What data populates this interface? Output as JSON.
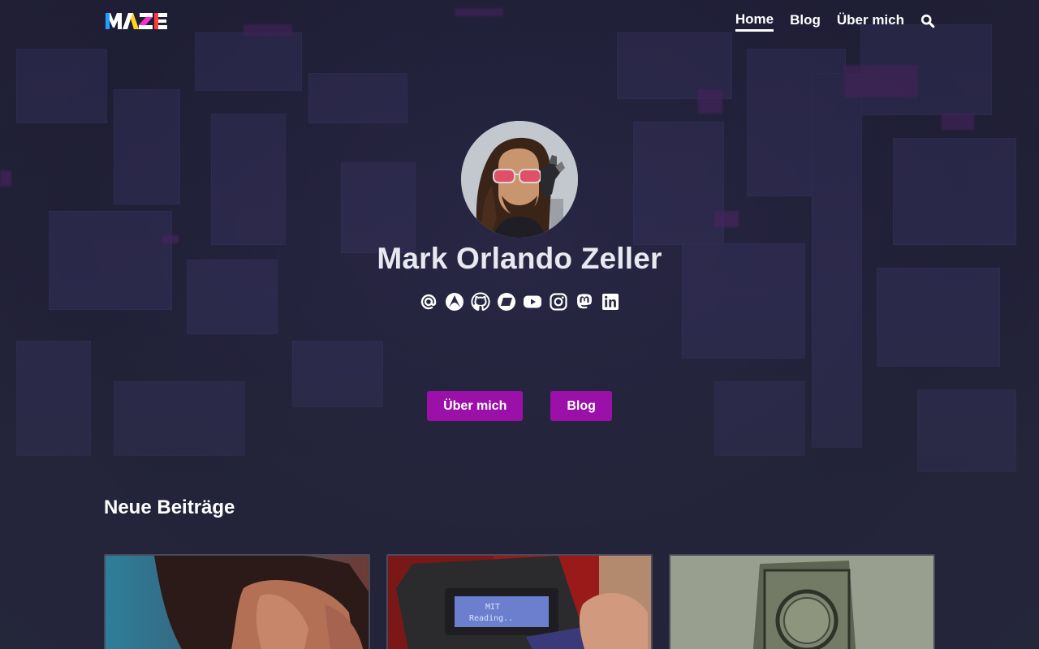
{
  "header": {
    "logo_letters": [
      "M",
      "A",
      "Z",
      "E"
    ],
    "nav": [
      {
        "label": "Home",
        "active": true
      },
      {
        "label": "Blog",
        "active": false
      },
      {
        "label": "Über mich",
        "active": false
      }
    ],
    "search_icon": "search-icon"
  },
  "hero": {
    "name": "Mark Orlando Zeller",
    "social_icons": [
      "at-icon",
      "arch-icon",
      "github-icon",
      "slanted-box-icon",
      "youtube-icon",
      "instagram-icon",
      "mastodon-icon",
      "linkedin-icon"
    ],
    "buttons": {
      "about": "Über mich",
      "blog": "Blog"
    }
  },
  "posts": {
    "title": "Neue Beiträge",
    "cards": [
      {
        "image": "person-face-photo"
      },
      {
        "image": "lcd-device-photo"
      },
      {
        "image": "metal-box-photo"
      }
    ]
  },
  "colors": {
    "accent": "#9b10a8",
    "background": "#26253f",
    "logo": [
      "#1ea0ff",
      "#ffd21e",
      "#ff2bd2",
      "#ff3b3b"
    ]
  }
}
